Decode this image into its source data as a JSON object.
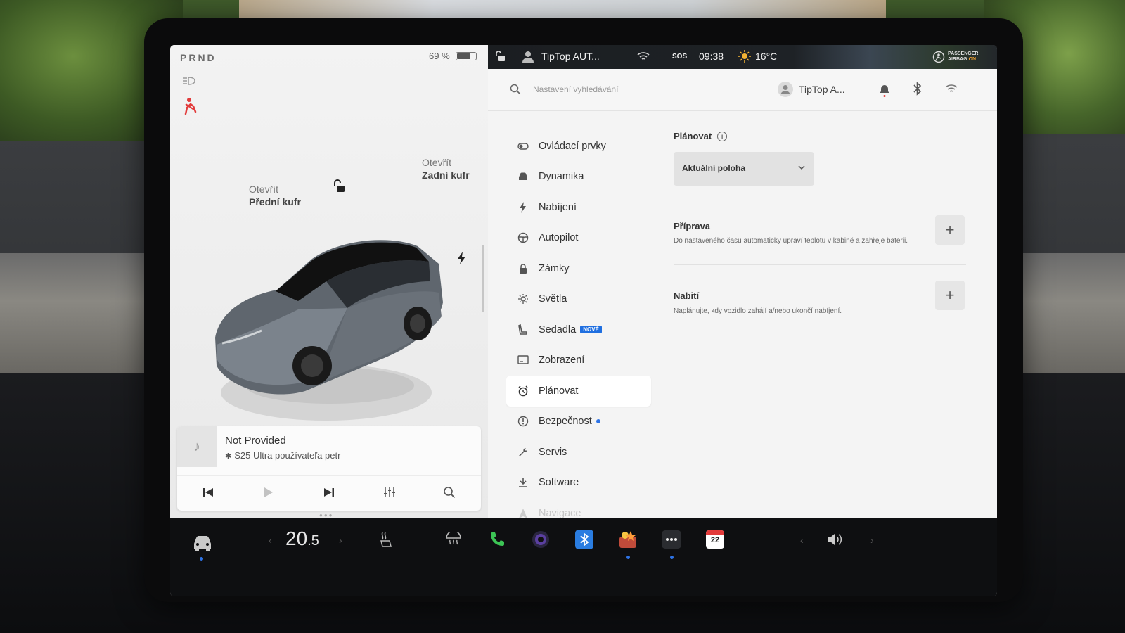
{
  "car_panel": {
    "gear": "PRND",
    "battery_percent_text": "69 %",
    "battery_level": 0.69,
    "frunk_action": "Otevřít",
    "frunk_label": "Přední kufr",
    "trunk_action": "Otevřít",
    "trunk_label": "Zadní kufr"
  },
  "media": {
    "title": "Not Provided",
    "source": "S25 Ultra používateľa petr"
  },
  "status_bar": {
    "profile": "TipTop AUT...",
    "sos": "SOS",
    "time": "09:38",
    "temperature": "16°C",
    "airbag_line1": "PASSENGER",
    "airbag_line2": "AIRBAG",
    "airbag_state": "ON"
  },
  "settings": {
    "search_placeholder": "Nastavení vyhledávání",
    "user_name": "TipTop A...",
    "nav": [
      {
        "label": "Ovládací prvky",
        "icon": "toggle-icon"
      },
      {
        "label": "Dynamika",
        "icon": "car-icon"
      },
      {
        "label": "Nabíjení",
        "icon": "bolt-icon"
      },
      {
        "label": "Autopilot",
        "icon": "steering-wheel-icon"
      },
      {
        "label": "Zámky",
        "icon": "lock-icon"
      },
      {
        "label": "Světla",
        "icon": "sun-icon"
      },
      {
        "label": "Sedadla",
        "icon": "seat-icon",
        "badge": "NOVÉ"
      },
      {
        "label": "Zobrazení",
        "icon": "display-icon"
      },
      {
        "label": "Plánovat",
        "icon": "alarm-clock-icon",
        "active": true
      },
      {
        "label": "Bezpečnost",
        "icon": "alert-icon",
        "dot": true
      },
      {
        "label": "Servis",
        "icon": "wrench-icon"
      },
      {
        "label": "Software",
        "icon": "download-icon"
      },
      {
        "label": "Navigace",
        "icon": "navigation-icon"
      }
    ],
    "schedule": {
      "title": "Plánovat",
      "location_value": "Aktuální poloha",
      "preparation_title": "Příprava",
      "preparation_desc": "Do nastaveného času automaticky upraví teplotu v kabině a zahřeje baterii.",
      "charge_title": "Nabití",
      "charge_desc": "Naplánujte, kdy vozidlo zahájí a/nebo ukončí nabíjení."
    }
  },
  "taskbar": {
    "cabin_temp_main": "20",
    "cabin_temp_decimal": ".5",
    "calendar_day": "22"
  },
  "colors": {
    "accent_blue": "#2d73e6",
    "seatbelt_red": "#e23b3b",
    "taskbar_bg": "#0e0f11"
  }
}
